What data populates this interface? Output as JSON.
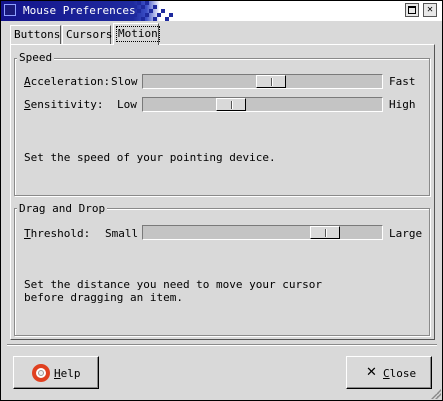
{
  "window": {
    "title": "Mouse Preferences",
    "maximize_glyph": "",
    "close_glyph": "✕"
  },
  "tabs": [
    {
      "label": "Buttons",
      "selected": false
    },
    {
      "label": "Cursors",
      "selected": false
    },
    {
      "label": "Motion",
      "selected": true
    }
  ],
  "speed": {
    "title": "Speed",
    "acceleration": {
      "label": "Acceleration:",
      "min_label": "Slow",
      "max_label": "Fast",
      "value": 0.54
    },
    "sensitivity": {
      "label": "Sensitivity:",
      "min_label": "Low",
      "max_label": "High",
      "value": 0.35
    },
    "description": "Set the speed of your pointing device."
  },
  "drag": {
    "title": "Drag and Drop",
    "threshold": {
      "label": "Threshold:",
      "min_label": "Small",
      "max_label": "Large",
      "value": 0.8
    },
    "description_line1": "Set the distance you need to move your cursor",
    "description_line2": "before dragging an item."
  },
  "buttons": {
    "help": {
      "label": "Help",
      "icon": "lifebuoy-icon"
    },
    "close": {
      "label": "Close",
      "icon": "close-x-icon",
      "glyph": "✕"
    }
  },
  "colors": {
    "titlebar": "#14148c",
    "background": "#d9d9d9"
  }
}
